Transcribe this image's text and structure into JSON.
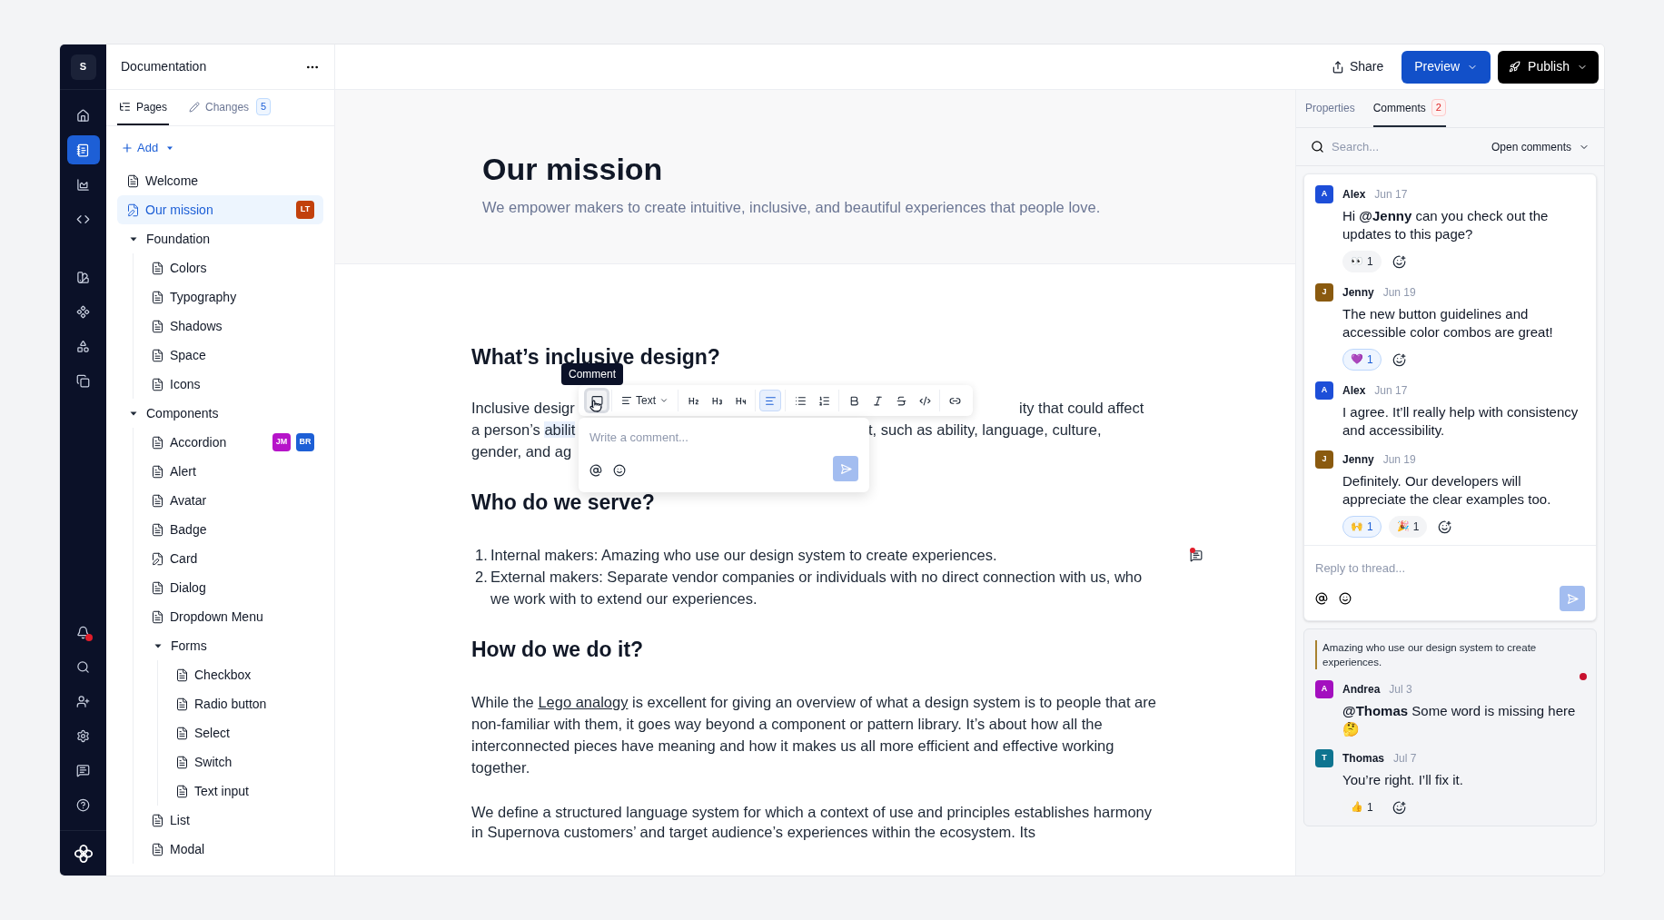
{
  "rail": {
    "logo": "S",
    "top_items": [
      {
        "selected": false
      },
      {
        "selected": true
      },
      {
        "selected": false
      },
      {
        "selected": false
      }
    ],
    "tool_items": [
      {
        "selected": false
      },
      {
        "selected": false
      },
      {
        "selected": false
      },
      {
        "selected": false
      }
    ],
    "bottom_items": [
      {
        "badge": true
      },
      {
        "badge": false
      },
      {
        "badge": false
      },
      {
        "badge": false
      },
      {
        "badge": false
      },
      {
        "badge": false
      }
    ]
  },
  "sidebar": {
    "title": "Documentation",
    "tabs": [
      {
        "label": "Pages",
        "selected": true
      },
      {
        "label": "Changes",
        "selected": false,
        "count": "5"
      }
    ],
    "add_button": "Add",
    "tree": [
      {
        "kind": "page",
        "label": "Welcome",
        "selected": false,
        "edited": false
      },
      {
        "kind": "page",
        "label": "Our mission",
        "selected": true,
        "edited": true,
        "badges": [
          {
            "text": "LT",
            "color": "#c2410c"
          }
        ]
      },
      {
        "kind": "folder",
        "label": "Foundation",
        "expanded": true,
        "children": [
          {
            "kind": "page",
            "label": "Colors",
            "selected": false,
            "edited": false
          },
          {
            "kind": "page",
            "label": "Typography",
            "selected": false,
            "edited": false
          },
          {
            "kind": "page",
            "label": "Shadows",
            "selected": false,
            "edited": false
          },
          {
            "kind": "page",
            "label": "Space",
            "selected": false,
            "edited": false
          },
          {
            "kind": "page",
            "label": "Icons",
            "selected": false,
            "edited": false
          }
        ]
      },
      {
        "kind": "folder",
        "label": "Components",
        "expanded": true,
        "children": [
          {
            "kind": "page",
            "label": "Accordion",
            "selected": false,
            "edited": false,
            "badges": [
              {
                "text": "JM",
                "color": "#b614c9"
              },
              {
                "text": "BR",
                "color": "#1d5fd6"
              }
            ]
          },
          {
            "kind": "page",
            "label": "Alert",
            "selected": false,
            "edited": false
          },
          {
            "kind": "page",
            "label": "Avatar",
            "selected": false,
            "edited": false
          },
          {
            "kind": "page",
            "label": "Badge",
            "selected": false,
            "edited": false
          },
          {
            "kind": "page",
            "label": "Card",
            "selected": false,
            "edited": true
          },
          {
            "kind": "page",
            "label": "Dialog",
            "selected": false,
            "edited": false
          },
          {
            "kind": "page",
            "label": "Dropdown Menu",
            "selected": false,
            "edited": false
          },
          {
            "kind": "folder",
            "label": "Forms",
            "expanded": true,
            "children": [
              {
                "kind": "page",
                "label": "Checkbox",
                "selected": false,
                "edited": false
              },
              {
                "kind": "page",
                "label": "Radio button",
                "selected": false,
                "edited": false
              },
              {
                "kind": "page",
                "label": "Select",
                "selected": false,
                "edited": false
              },
              {
                "kind": "page",
                "label": "Switch",
                "selected": false,
                "edited": false
              },
              {
                "kind": "page",
                "label": "Text input",
                "selected": false,
                "edited": false
              }
            ]
          },
          {
            "kind": "page",
            "label": "List",
            "selected": false,
            "edited": false
          },
          {
            "kind": "page",
            "label": "Modal",
            "selected": false,
            "edited": false
          }
        ]
      }
    ]
  },
  "header": {
    "share": "Share",
    "preview": "Preview",
    "publish": "Publish"
  },
  "editor": {
    "title": "Our mission",
    "subtitle": "We empower makers to create intuitive, inclusive, and beautiful experiences that people love.",
    "heading_1": "What’s inclusive design?",
    "obscured_paragraph": [
      {
        "left": "Inclusive desigr",
        "right": "ity that could affect"
      },
      {
        "left": "a person’s ",
        "highlight": "abilit",
        "right": "t, such as ability, language, culture,"
      },
      {
        "left": "gender, and ag"
      }
    ],
    "heading_2": "Who do we serve?",
    "list": [
      {
        "number": "1.",
        "text": "Internal makers: Amazing who use our design system to create experiences.",
        "comment_marker": true
      },
      {
        "number": "2.",
        "text": "External makers: Separate vendor companies or individuals with no direct connection with us, who we work with to extend our experiences.",
        "comment_marker": false
      }
    ],
    "heading_3": "How do we do it?",
    "paragraph_1": {
      "before": "While the ",
      "link": "Lego analogy",
      "after": " is excellent for giving an overview of what a design system is to people that are non-familiar with them, it goes way beyond a component or pattern library. It’s about how all the interconnected pieces have meaning and how it makes us all more efficient and effective working together."
    },
    "paragraph_2": "We define a structured language system for which a context of use and principles establishes harmony in Supernova customers’ and target audience’s experiences within the ecosystem. Its",
    "tooltip": "Comment",
    "toolbar": [
      [
        {
          "kind": "comment",
          "selected": false,
          "hovered": true
        }
      ],
      [
        {
          "kind": "text_style",
          "label": "Text",
          "selected": false,
          "hovered": false
        }
      ],
      [
        {
          "kind": "h2",
          "selected": false,
          "hovered": false
        },
        {
          "kind": "h3",
          "selected": false,
          "hovered": false
        },
        {
          "kind": "h4",
          "selected": false,
          "hovered": false
        }
      ],
      [
        {
          "kind": "align",
          "selected": true,
          "hovered": false
        }
      ],
      [
        {
          "kind": "bullets",
          "selected": false,
          "hovered": false
        },
        {
          "kind": "numbers",
          "selected": false,
          "hovered": false
        }
      ],
      [
        {
          "kind": "bold",
          "selected": false,
          "hovered": false
        },
        {
          "kind": "italic",
          "selected": false,
          "hovered": false
        },
        {
          "kind": "strike",
          "selected": false,
          "hovered": false
        },
        {
          "kind": "code",
          "selected": false,
          "hovered": false
        }
      ],
      [
        {
          "kind": "link",
          "selected": false,
          "hovered": false
        }
      ]
    ],
    "comment_box": {
      "placeholder": "Write a comment..."
    }
  },
  "panel": {
    "tabs": [
      {
        "label": "Properties",
        "selected": false
      },
      {
        "label": "Comments",
        "selected": true,
        "count": "2"
      }
    ],
    "search": {
      "placeholder": "Search..."
    },
    "filter": "Open comments",
    "threads": [
      {
        "selected": true,
        "unread": false,
        "comments": [
          {
            "initial": "A",
            "color": "#1d4ed8",
            "author": "Alex",
            "date": "Jun 17",
            "text": "Hi **@Jenny** can you check out the updates to this page?",
            "reactions": [
              {
                "emoji": "👀",
                "count": "1",
                "selected": false
              }
            ]
          },
          {
            "initial": "J",
            "color": "#8a5a0f",
            "author": "Jenny",
            "date": "Jun 19",
            "text": "The new button guidelines and accessible color combos are great!",
            "reactions": [
              {
                "emoji": "💜",
                "count": "1",
                "selected": true
              }
            ]
          },
          {
            "initial": "A",
            "color": "#1d4ed8",
            "author": "Alex",
            "date": "Jun 17",
            "text": "I agree. It’ll really help with consistency and accessibility."
          },
          {
            "initial": "J",
            "color": "#8a5a0f",
            "author": "Jenny",
            "date": "Jun 19",
            "text": "Definitely. Our developers will appreciate the clear examples too.",
            "reactions": [
              {
                "emoji": "🙌",
                "count": "1",
                "selected": true
              },
              {
                "emoji": "🎉",
                "count": "1",
                "selected": false
              }
            ]
          }
        ],
        "reply_placeholder": "Reply to thread..."
      },
      {
        "selected": false,
        "unread": true,
        "quote": "Amazing who use our design system to create experiences.",
        "comments": [
          {
            "initial": "A",
            "color": "#a30fbf",
            "author": "Andrea",
            "date": "Jul 3",
            "text": "**@Thomas** Some word is missing here 🤔"
          },
          {
            "initial": "T",
            "color": "#0e7490",
            "author": "Thomas",
            "date": "Jul 7",
            "text": "You’re right. I’ll fix it.",
            "reactions": [
              {
                "emoji": "👍",
                "count": "1",
                "selected": false
              }
            ]
          }
        ]
      }
    ]
  }
}
